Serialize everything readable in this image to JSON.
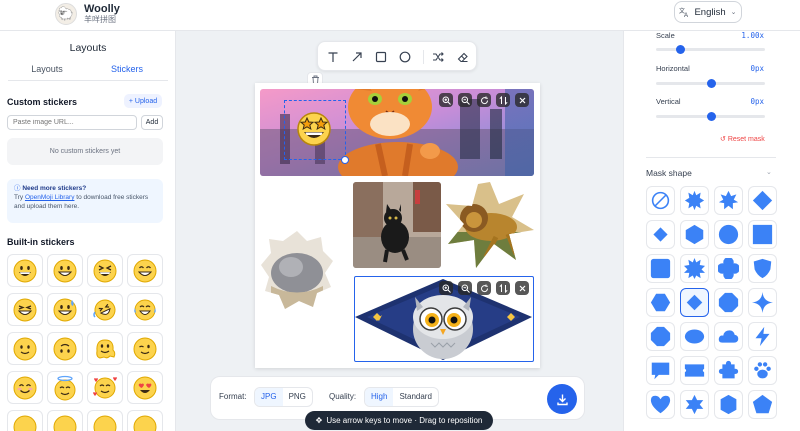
{
  "app": {
    "title": "Woolly",
    "subtitle": "羊咩拼图"
  },
  "language": {
    "label": "English"
  },
  "left_panel": {
    "title": "Layouts",
    "tabs": [
      {
        "label": "Layouts"
      },
      {
        "label": "Stickers"
      }
    ],
    "custom_stickers": {
      "heading": "Custom stickers",
      "upload_label": "+ Upload",
      "url_placeholder": "Paste image URL...",
      "add_label": "Add",
      "empty_text": "No custom stickers yet"
    },
    "help": {
      "title": "Need more stickers?",
      "text_before": "Try ",
      "link": "OpenMoji Library",
      "text_after": " to download free stickers and upload them here."
    },
    "builtin_heading": "Built-in stickers",
    "builtin": [
      "grinning face",
      "beaming face",
      "grinning squinting face",
      "grinning face with big eyes",
      "grinning face with sweat",
      "grinning face with sweat drop",
      "rolling on the floor laughing",
      "face with tears of joy",
      "slightly smiling face",
      "upside-down face",
      "melting face",
      "winking face",
      "smiling face with smiling eyes",
      "smiling face with halo",
      "smiling face with hearts",
      "smiling face with heart-eyes"
    ]
  },
  "toolbar": {
    "tools": [
      "text-tool",
      "arrow-tool",
      "rectangle-tool",
      "circle-tool",
      "shuffle-tool",
      "eraser-tool"
    ]
  },
  "canvas": {
    "photos": [
      "orange cat photo",
      "black cat photo",
      "lion photo",
      "grey cat photo",
      "owl illustration"
    ],
    "selected_sticker": "star-struck face",
    "image_controls": [
      "zoom-in",
      "zoom-out",
      "rotate",
      "swap",
      "remove"
    ]
  },
  "bottom_bar": {
    "format_label": "Format:",
    "formats": [
      {
        "label": "JPG",
        "active": true
      },
      {
        "label": "PNG",
        "active": false
      }
    ],
    "quality_label": "Quality:",
    "qualities": [
      {
        "label": "High",
        "active": true
      },
      {
        "label": "Standard",
        "active": false
      }
    ]
  },
  "toast": {
    "text": "Use arrow keys to move · Drag to reposition"
  },
  "right_panel": {
    "scale": {
      "label": "Scale",
      "value": "1.00x",
      "level": 0.22
    },
    "horizontal": {
      "label": "Horizontal",
      "value": "0px",
      "level": 0.5
    },
    "vertical": {
      "label": "Vertical",
      "value": "0px",
      "level": 0.5
    },
    "reset_label": "Reset mask",
    "mask_shape_label": "Mask shape",
    "shapes": [
      "none",
      "burst",
      "star-8",
      "diamond",
      "diamond-small",
      "hexagon",
      "circle",
      "square",
      "square-round",
      "star-12",
      "flower",
      "shield",
      "hexagon-flat",
      "diamond-selected",
      "octagon-badge",
      "sparkle",
      "octagon",
      "ellipse",
      "cloud",
      "lightning",
      "speech-bubble",
      "ticket",
      "puzzle",
      "paw",
      "heart",
      "star-6",
      "hexagon-tall",
      "pentagon"
    ],
    "selected_shape": "diamond-selected"
  },
  "colors": {
    "accent": "#2563eb",
    "shape_fill": "#3b82f6",
    "danger": "#ef4444"
  }
}
